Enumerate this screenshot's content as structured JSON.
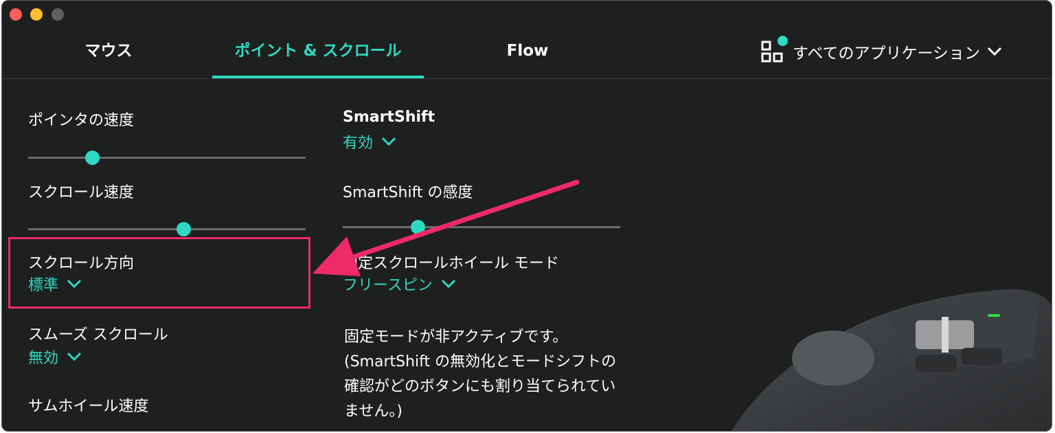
{
  "tabs": {
    "mouse": "マウス",
    "point_scroll": "ポイント & スクロール",
    "flow": "Flow"
  },
  "apps_selector": {
    "label": "すべてのアプリケーション"
  },
  "settings": {
    "pointer_speed": {
      "label": "ポインタの速度",
      "value": 0.23
    },
    "scroll_speed": {
      "label": "スクロール速度",
      "value": 0.56
    },
    "scroll_direction": {
      "label": "スクロール方向",
      "value": "標準"
    },
    "smooth_scroll": {
      "label": "スムーズ スクロール",
      "value": "無効"
    },
    "thumb_wheel_speed": {
      "label": "サムホイール速度"
    },
    "smartshift": {
      "label": "SmartShift",
      "value": "有効"
    },
    "smartshift_sensitivity": {
      "label": "SmartShift の感度",
      "value": 0.27
    },
    "fixed_wheel_mode": {
      "label": "固定スクロールホイール モード",
      "value": "フリースピン"
    },
    "fixed_mode_note": "固定モードが非アクティブです。(SmartShift の無効化とモードシフトの確認がどのボタンにも割り当てられていません。)"
  },
  "colors": {
    "accent": "#2ed9c3",
    "highlight": "#ee2a68",
    "background": "#1e1f1f"
  }
}
